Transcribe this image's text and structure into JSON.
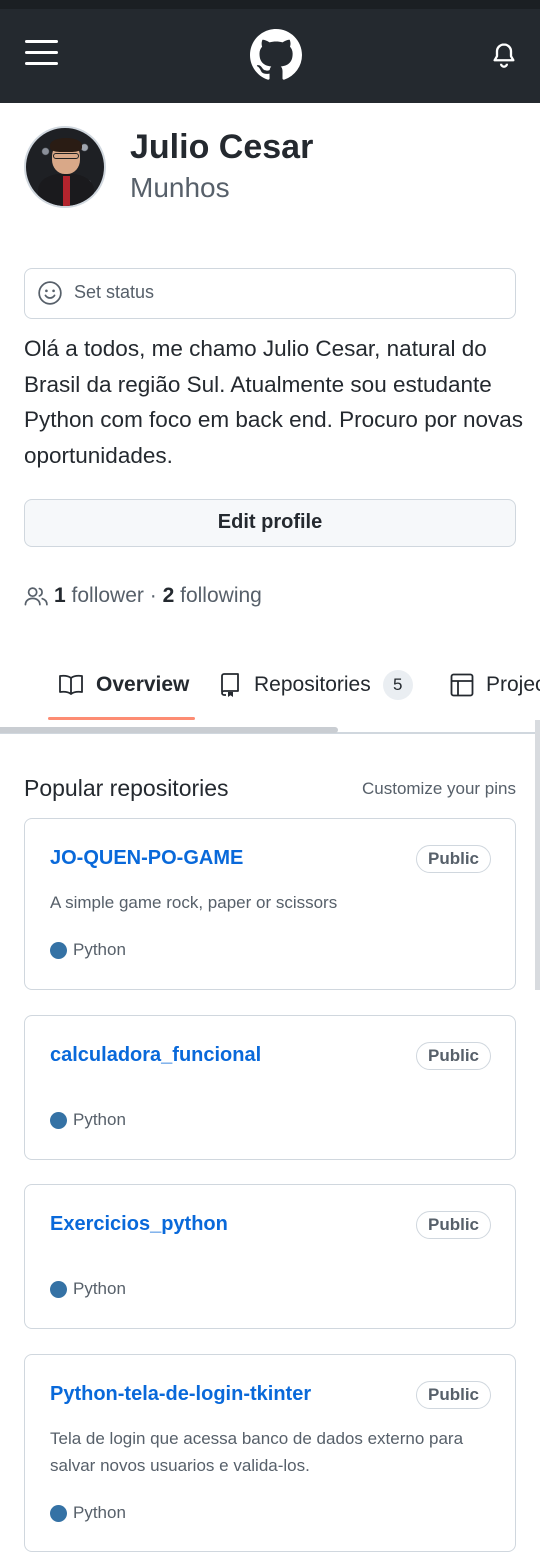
{
  "header": {
    "menu_icon": "hamburger-menu-icon",
    "logo_icon": "github-logo-icon",
    "notification_icon": "bell-icon"
  },
  "profile": {
    "name": "Julio Cesar",
    "login": "Munhos",
    "avatar": "user-avatar-photo"
  },
  "status": {
    "icon": "smiley-icon",
    "label": "Set status"
  },
  "bio": "Olá a todos, me chamo Julio Cesar, natural do Brasil da região Sul. Atualmente sou estudante Python com foco em back end. Procuro por novas oportunidades.",
  "edit_profile_label": "Edit profile",
  "follow": {
    "followers_count": "1",
    "followers_label": "follower",
    "separator": "·",
    "following_count": "2",
    "following_label": "following"
  },
  "tabs": [
    {
      "label": "Overview",
      "icon": "book-icon",
      "active": true
    },
    {
      "label": "Repositories",
      "icon": "repo-icon",
      "count": "5"
    },
    {
      "label": "Projects",
      "icon": "table-icon"
    }
  ],
  "pinned": {
    "title": "Popular repositories",
    "customize_label": "Customize your pins",
    "repos": [
      {
        "name": "JO-QUEN-PO-GAME",
        "visibility": "Public",
        "description": "A simple game rock, paper or scissors",
        "language": "Python",
        "language_color": "#3572A5"
      },
      {
        "name": "calculadora_funcional",
        "visibility": "Public",
        "description": "",
        "language": "Python",
        "language_color": "#3572A5"
      },
      {
        "name": "Exercicios_python",
        "visibility": "Public",
        "description": "",
        "language": "Python",
        "language_color": "#3572A5"
      },
      {
        "name": "Python-tela-de-login-tkinter",
        "visibility": "Public",
        "description": "Tela de login que acessa banco de dados externo para salvar novos usuarios e valida-los.",
        "language": "Python",
        "language_color": "#3572A5"
      }
    ]
  },
  "colors": {
    "header_bg": "#24292F",
    "link": "#0969DA",
    "tab_active_underline": "#FD8C73",
    "border": "#D0D7DE"
  }
}
